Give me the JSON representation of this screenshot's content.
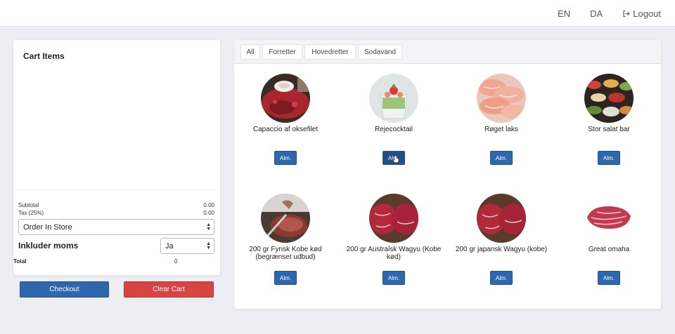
{
  "nav": {
    "lang_en": "EN",
    "lang_da": "DA",
    "logout": "Logout"
  },
  "cart": {
    "title": "Cart Items",
    "subtotal_label": "Subtotal",
    "subtotal_value": "0.00",
    "tax_label": "Tax (25%)",
    "tax_value": "0.00",
    "order_type": "Order In Store",
    "moms_label": "Inkluder moms",
    "moms_value": "Ja",
    "total_label": "Total",
    "total_value": "0"
  },
  "actions": {
    "checkout": "Checkout",
    "clear": "Clear Cart"
  },
  "tabs": [
    "All",
    "Forretter",
    "Hovedretter",
    "Sodavand"
  ],
  "products": [
    {
      "name": "Capaccio af oksefilet",
      "button": "Alm."
    },
    {
      "name": "Rejecocktail",
      "button": "Alm."
    },
    {
      "name": "Røget laks",
      "button": "Alm."
    },
    {
      "name": "Stor salat bar",
      "button": "Alm."
    },
    {
      "name": "200 gr Fynsk Kobe kød (begrænset udbud)",
      "button": "Alm."
    },
    {
      "name": "200 gr Australsk Wagyu (Kobe kød)",
      "button": "Alm."
    },
    {
      "name": "200 gr japansk Wagyu (kobe)",
      "button": "Alm."
    },
    {
      "name": "Great omaha",
      "button": "Alm."
    }
  ],
  "colors": {
    "primary": "#2f67ad",
    "danger": "#d64444",
    "background": "#eceef3"
  }
}
